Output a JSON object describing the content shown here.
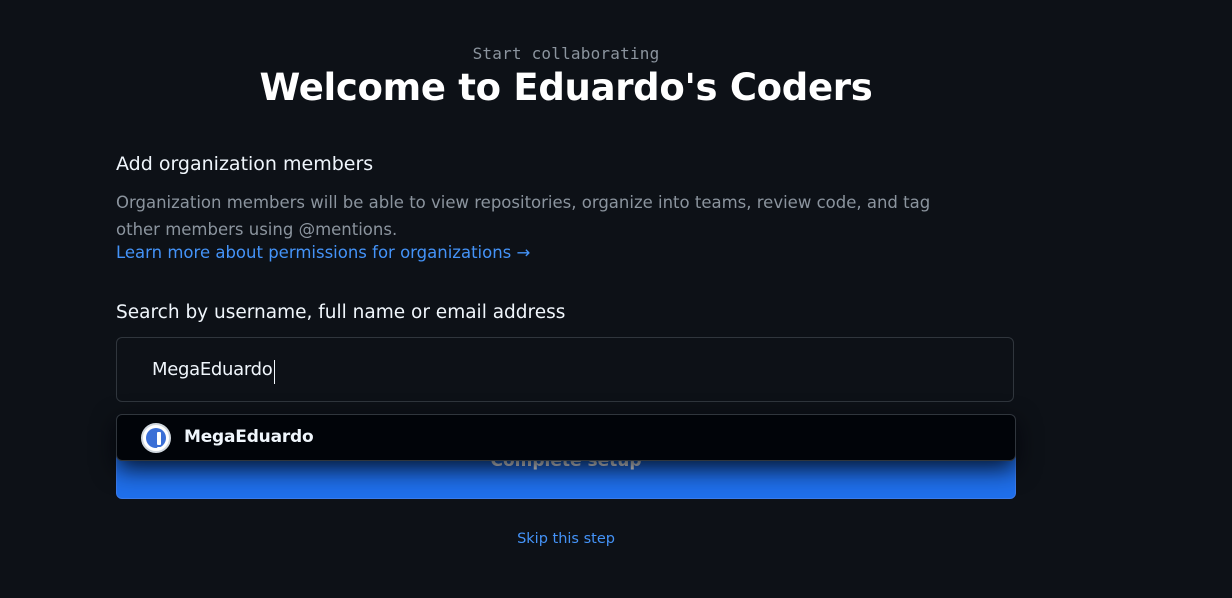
{
  "header": {
    "eyebrow": "Start collaborating",
    "title": "Welcome to Eduardo's Coders"
  },
  "members_section": {
    "heading": "Add organization members",
    "description": "Organization members will be able to view repositories, organize into teams, review code, and tag other members using @mentions.",
    "learn_more_link": "Learn more about permissions for organizations →"
  },
  "search": {
    "label": "Search by username, full name or email address",
    "value": "MegaEduardo",
    "placeholder": ""
  },
  "suggestions": [
    {
      "username": "MegaEduardo",
      "avatar_icon": "exclamation-avatar-icon"
    }
  ],
  "actions": {
    "complete_label": "Complete setup",
    "skip_label": "Skip this step"
  },
  "colors": {
    "background": "#0d1117",
    "primary_button": "#1f6feb",
    "link": "#4493f8",
    "muted_text": "#8b949e"
  }
}
